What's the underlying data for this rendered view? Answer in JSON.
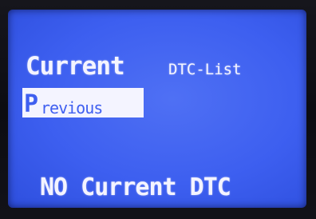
{
  "screen": {
    "menu": {
      "current_label": "Current",
      "section_title": "DTC-List",
      "previous_label_first": "P",
      "previous_label_rest": "revious"
    },
    "status_message": "NO Current DTC"
  },
  "colors": {
    "lcd_background": "#3d5ff0",
    "lcd_text": "#f4f4ff",
    "highlight_background": "#f4f4ff",
    "highlight_text": "#3f5ff0"
  }
}
